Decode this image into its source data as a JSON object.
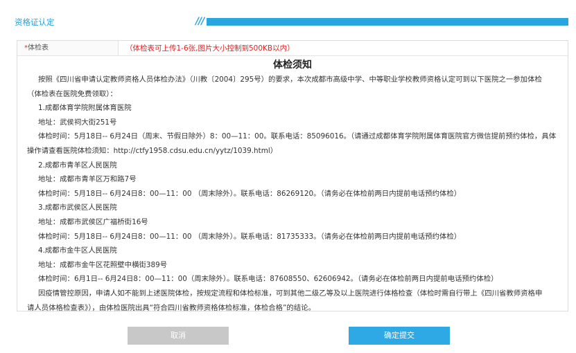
{
  "header": {
    "section_title": "资格证认定",
    "decoration": "///"
  },
  "field": {
    "required_mark": "*",
    "label": "体检表",
    "hint": "（体检表可上传1-6张,图片大小控制到500KB以内）"
  },
  "notice": {
    "title": "体检须知",
    "intro": "按照《四川省申请认定教师资格人员体检办法》（川教〔2004〕295号）的要求，本次成都市高级中学、中等职业学校教师资格认定可到以下医院之一参加体检",
    "intro_cont": "（体检表在医院免费领取）：",
    "hospitals": [
      {
        "name": "1.成都体育学院附属体育医院",
        "address": "地址：武侯祠大街251号",
        "time": "体检时间：5月18日-- 6月24日（周末、节假日除外）8：00—11：00。联系电话：85096016。（请通过成都体育学院附属体育医院官方微信提前预约体检，具体",
        "time_cont": "操作请查看医院体检须知：http://ctfy1958.cdsu.edu.cn/yytz/1039.html）"
      },
      {
        "name": "2.成都市青羊区人民医院",
        "address": "地址：成都市青羊区万和路7号",
        "time": "体检时间：5月18日-- 6月24日8：00—11：00 （周末除外）。联系电话：86269120。（请务必在体检前两日内提前电话预约体检）",
        "time_cont": ""
      },
      {
        "name": "3.成都市武侯区人民医院",
        "address": "地址：成都市武侯区广福桥街16号",
        "time": "体检时间：5月18日-- 6月24日8：00—11：00 （周末除外）。联系电话：81735333。（请务必在体检前两日内提前电话预约体检）",
        "time_cont": ""
      },
      {
        "name": "4.成都市金牛区人民医院",
        "address": "地址：成都市金牛区花照壁中横街389号",
        "time": "体检时间：6月1日-- 6月24日8：00—11：00（周末除外）。联系电话：87608550、62606942。（请务必在体检前两日内提前电话预约体检）",
        "time_cont": ""
      }
    ],
    "epidemic": "因疫情管控原因，申请人如不能到上述医院体检，按规定流程和体检标准，可到其他二级乙等及以上医院进行体格检查（体检时需自行带上《四川省教师资格申",
    "epidemic_cont": "请人员体格检查表》），由体检医院出具“符合四川省教师资格体检标准，体检合格”的结论。"
  },
  "buttons": {
    "cancel_label": "取消",
    "submit_label": "确定提交"
  },
  "colors": {
    "accent": "#2aa5e0",
    "hint_red": "#e01e1e",
    "cancel_bg": "#c8c8c8",
    "submit_bg": "#2ea9e6"
  }
}
